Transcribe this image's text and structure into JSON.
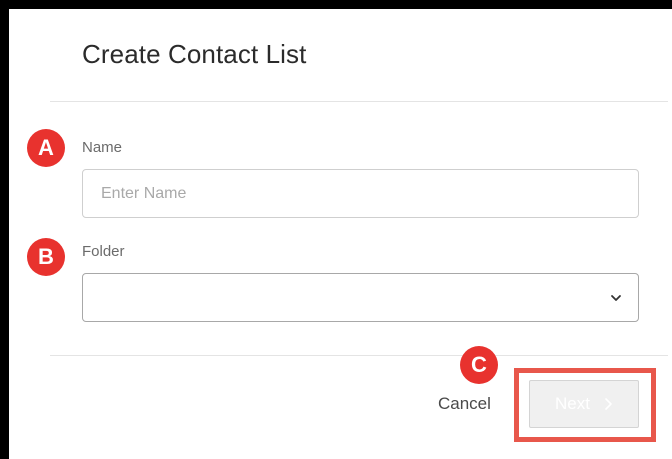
{
  "dialog": {
    "title": "Create Contact List"
  },
  "fields": {
    "name": {
      "label": "Name",
      "value": "",
      "placeholder": "Enter Name"
    },
    "folder": {
      "label": "Folder",
      "selected": "",
      "icon": "chevron-down-icon"
    }
  },
  "footer": {
    "cancel_label": "Cancel",
    "next_label": "Next",
    "next_icon": "chevron-right-icon",
    "next_enabled": false
  },
  "annotations": {
    "a": "A",
    "b": "B",
    "c": "C",
    "marker_color": "#e8322e",
    "highlight_color": "#e8574b"
  }
}
